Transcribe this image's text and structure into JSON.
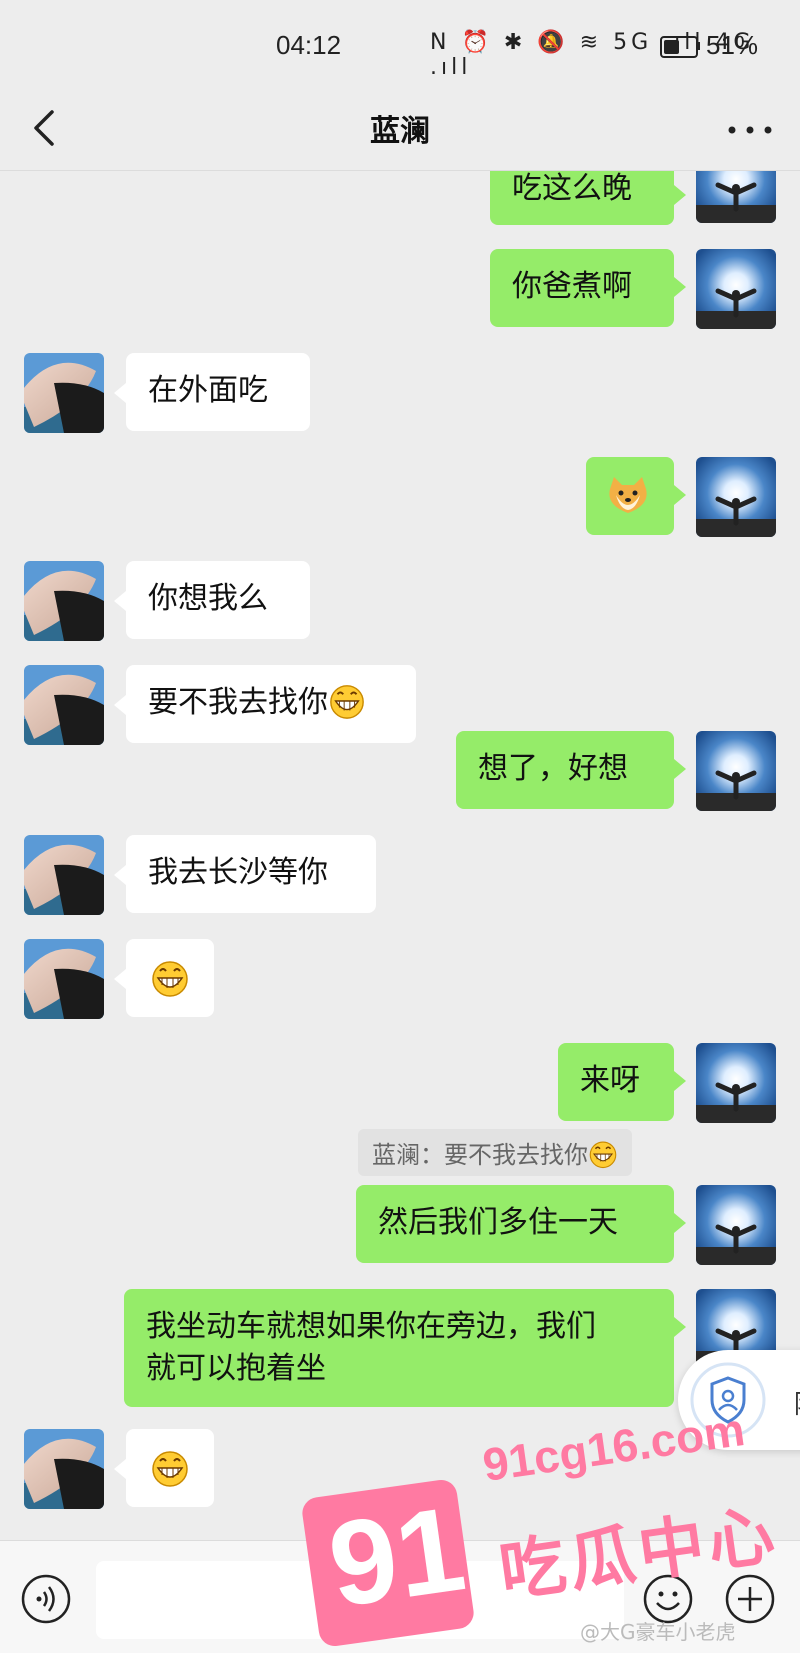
{
  "status": {
    "time": "04:12",
    "icons": "N ⏰ ✱ 🔕 ≋ 5G .ıll 4G .ıll",
    "battery": "51%",
    "battery_level": 0.51
  },
  "header": {
    "title": "蓝澜"
  },
  "messages": {
    "m1": "吃这么晚",
    "m2": "你爸煮啊",
    "m3": "在外面吃",
    "m5": "你想我么",
    "m6": "要不我去找你",
    "m7": "想了，好想",
    "m8": "我去长沙等你",
    "m10": "来呀",
    "quote": "蓝澜：要不我去找你",
    "m11": "然后我们多住一天",
    "m12_line1": "我坐动车就想如果你在旁边，我们",
    "m12_line2": "就可以抱着坐"
  },
  "floating": {
    "label": "陌"
  },
  "watermark": {
    "number": "91",
    "url": "91cg16.com",
    "name": "吃瓜中心",
    "weibo": "@大G豪车小老虎"
  },
  "colors": {
    "background": "#ededed",
    "my_bubble": "#95ec69",
    "their_bubble": "#ffffff",
    "watermark": "#ff7aa2"
  }
}
